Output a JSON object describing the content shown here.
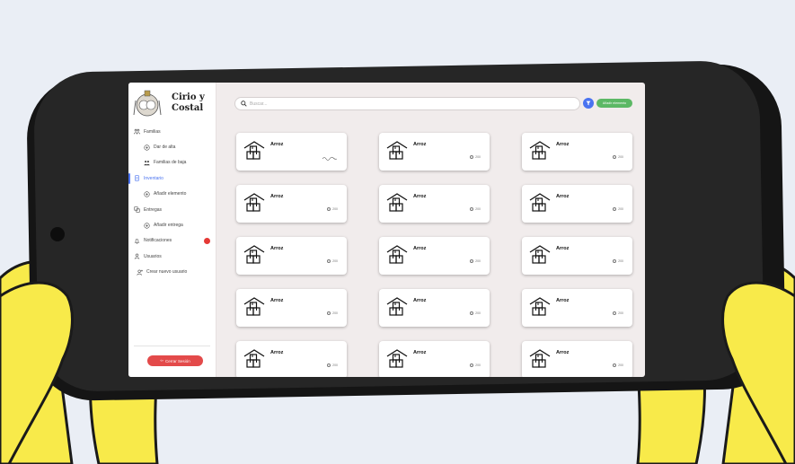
{
  "brand": {
    "name_line1": "Cirio y",
    "name_line2": "Costal"
  },
  "sidebar": {
    "items": [
      {
        "label": "Familias",
        "icon": "families-icon",
        "level": "top",
        "active": false
      },
      {
        "label": "Dar de alta",
        "icon": "add-circle-icon",
        "level": "sub",
        "active": false
      },
      {
        "label": "Familias de baja",
        "icon": "families-off-icon",
        "level": "sub",
        "active": false
      },
      {
        "label": "Inventario",
        "icon": "inventory-icon",
        "level": "top",
        "active": true
      },
      {
        "label": "Añadir elemento",
        "icon": "add-circle-icon",
        "level": "sub",
        "active": false
      },
      {
        "label": "Entregas",
        "icon": "deliveries-icon",
        "level": "top",
        "active": false
      },
      {
        "label": "Añadir entrega",
        "icon": "add-circle-icon",
        "level": "sub",
        "active": false
      },
      {
        "label": "Notificaciones",
        "icon": "bell-icon",
        "level": "top",
        "active": false
      },
      {
        "label": "Usuarios",
        "icon": "user-icon",
        "level": "top",
        "active": false
      },
      {
        "label": "Crear nuevo usuario",
        "icon": "user-add-icon",
        "level": "sub2",
        "active": false
      }
    ],
    "logout_label": "Cerrar Sesión"
  },
  "search": {
    "placeholder": "Buscar..."
  },
  "toolbar": {
    "add_label": "Añadir elemento"
  },
  "colors": {
    "accent": "#4a73f0",
    "add": "#5cb865",
    "logout": "#e34a4a",
    "badge": "#e53935"
  },
  "inventory": {
    "cards": [
      {
        "title": "Arroz",
        "qty": ""
      },
      {
        "title": "Arroz",
        "qty": "200"
      },
      {
        "title": "Arroz",
        "qty": "200"
      },
      {
        "title": "Arroz",
        "qty": "200"
      },
      {
        "title": "Arroz",
        "qty": "200"
      },
      {
        "title": "Arroz",
        "qty": "200"
      },
      {
        "title": "Arroz",
        "qty": "200"
      },
      {
        "title": "Arroz",
        "qty": "200"
      },
      {
        "title": "Arroz",
        "qty": "200"
      },
      {
        "title": "Arroz",
        "qty": "200"
      },
      {
        "title": "Arroz",
        "qty": "200"
      },
      {
        "title": "Arroz",
        "qty": "200"
      },
      {
        "title": "Arroz",
        "qty": "200"
      },
      {
        "title": "Arroz",
        "qty": "200"
      },
      {
        "title": "Arroz",
        "qty": "200"
      }
    ]
  }
}
